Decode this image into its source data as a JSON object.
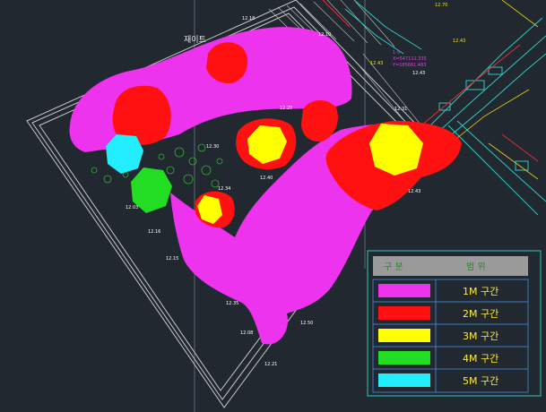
{
  "drawing": {
    "area_label": "재이트",
    "elevations": [
      "12.18",
      "12.10",
      "12.43",
      "12.43",
      "12.20",
      "12.30",
      "12.40",
      "12.31",
      "12.34",
      "12.03",
      "12.16",
      "12.15",
      "12.35",
      "12.50",
      "12.08",
      "12.21"
    ],
    "yellow_marks": [
      "12.70",
      "12.43",
      "12.43"
    ],
    "coord_label": "1-5",
    "coord_x": "X=547112.335",
    "coord_y": "Y=185661.483"
  },
  "legend": {
    "header_left": "구 분",
    "header_right": "범 위",
    "rows": [
      {
        "color": "#ee33ee",
        "label": "1M 구간"
      },
      {
        "color": "#ff1111",
        "label": "2M 구간"
      },
      {
        "color": "#ffff00",
        "label": "3M 구간"
      },
      {
        "color": "#22dd22",
        "label": "4M 구간"
      },
      {
        "color": "#22eeff",
        "label": "5M 구간"
      }
    ]
  }
}
